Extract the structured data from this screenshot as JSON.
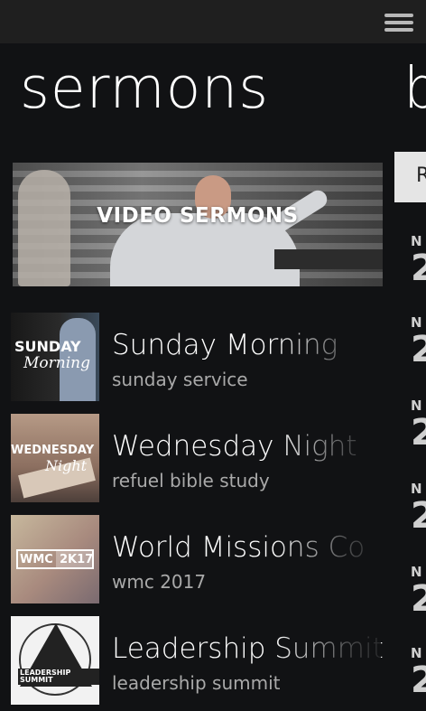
{
  "header": {
    "menu_icon": "hamburger-menu-icon"
  },
  "page": {
    "title": "sermons",
    "next_pivot_title": "b"
  },
  "hero": {
    "label": "VIDEO SERMONS"
  },
  "items": [
    {
      "title": "Sunday Morning",
      "subtitle": "sunday service",
      "thumb_text_1": "SUNDAY",
      "thumb_text_2": "Morning"
    },
    {
      "title": "Wednesday Night",
      "subtitle": "refuel bible study",
      "thumb_text_1": "WEDNESDAY",
      "thumb_text_2": "Night"
    },
    {
      "title": "World Missions Co",
      "subtitle": "wmc 2017",
      "thumb_text_1": "WMC",
      "thumb_text_2": "2K17"
    },
    {
      "title": "Leadership Summit",
      "subtitle": "leadership summit",
      "thumb_text_1": "LEADERSHIP SUMMIT",
      "thumb_text_2": ""
    }
  ],
  "peek": {
    "box_text": "R",
    "rows": [
      {
        "month": "N",
        "day": "2"
      },
      {
        "month": "N",
        "day": "2"
      },
      {
        "month": "N",
        "day": "2"
      },
      {
        "month": "N",
        "day": "2"
      },
      {
        "month": "N",
        "day": "2"
      },
      {
        "month": "N",
        "day": "2"
      }
    ]
  },
  "colors": {
    "background": "#111214",
    "topbar": "#1f1f1f",
    "subtitle": "#a9a9a9"
  }
}
